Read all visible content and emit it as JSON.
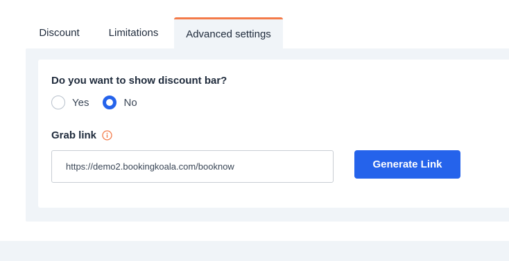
{
  "tabs": [
    {
      "label": "Discount",
      "active": false
    },
    {
      "label": "Limitations",
      "active": false
    },
    {
      "label": "Advanced settings",
      "active": true
    }
  ],
  "discount_bar": {
    "question": "Do you want to show discount bar?",
    "options": [
      {
        "label": "Yes",
        "selected": false
      },
      {
        "label": "No",
        "selected": true
      }
    ]
  },
  "grab_link": {
    "label": "Grab link",
    "info_icon": "info-circle-icon",
    "value": "https://demo2.bookingkoala.com/booknow",
    "button_label": "Generate Link"
  },
  "colors": {
    "accent": "#2563eb",
    "active_tab_border": "#f47a48",
    "info_icon": "#f47a48",
    "panel_bg": "#f0f4f8"
  }
}
